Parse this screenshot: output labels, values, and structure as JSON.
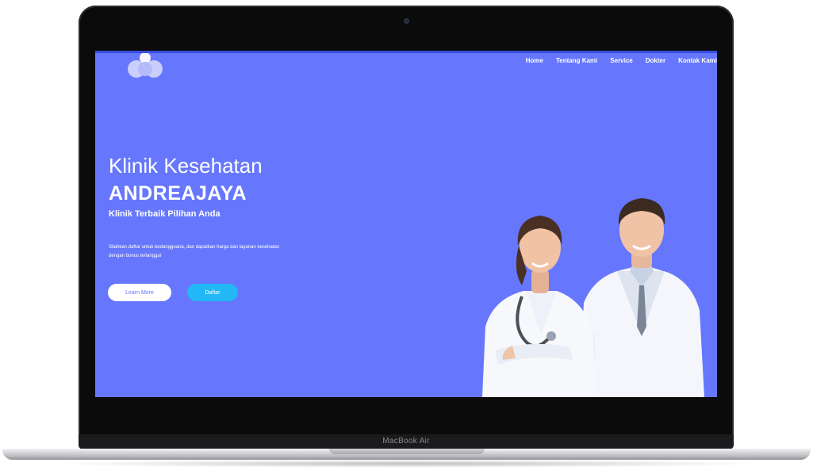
{
  "device": {
    "brand_label": "MacBook Air"
  },
  "colors": {
    "hero_background": "#6677fd",
    "accent_button": "#22b8f5",
    "text": "#ffffff"
  },
  "header": {
    "logo_icon": "clinic-logo-icon",
    "nav": [
      "Home",
      "Tentang Kami",
      "Service",
      "Dokter",
      "Kontak Kami"
    ]
  },
  "hero": {
    "title": "Klinik Kesehatan",
    "name": "ANDREAJAYA",
    "subtitle": "Klinik Terbaik Pilihan Anda",
    "description": "Silahkan daftar untuk bedanggoana, dan dapatkan harga dan layanan kesehatan dengan bonus terlanggar",
    "learn_more_label": "Learn More",
    "daftar_label": "Daftar"
  }
}
